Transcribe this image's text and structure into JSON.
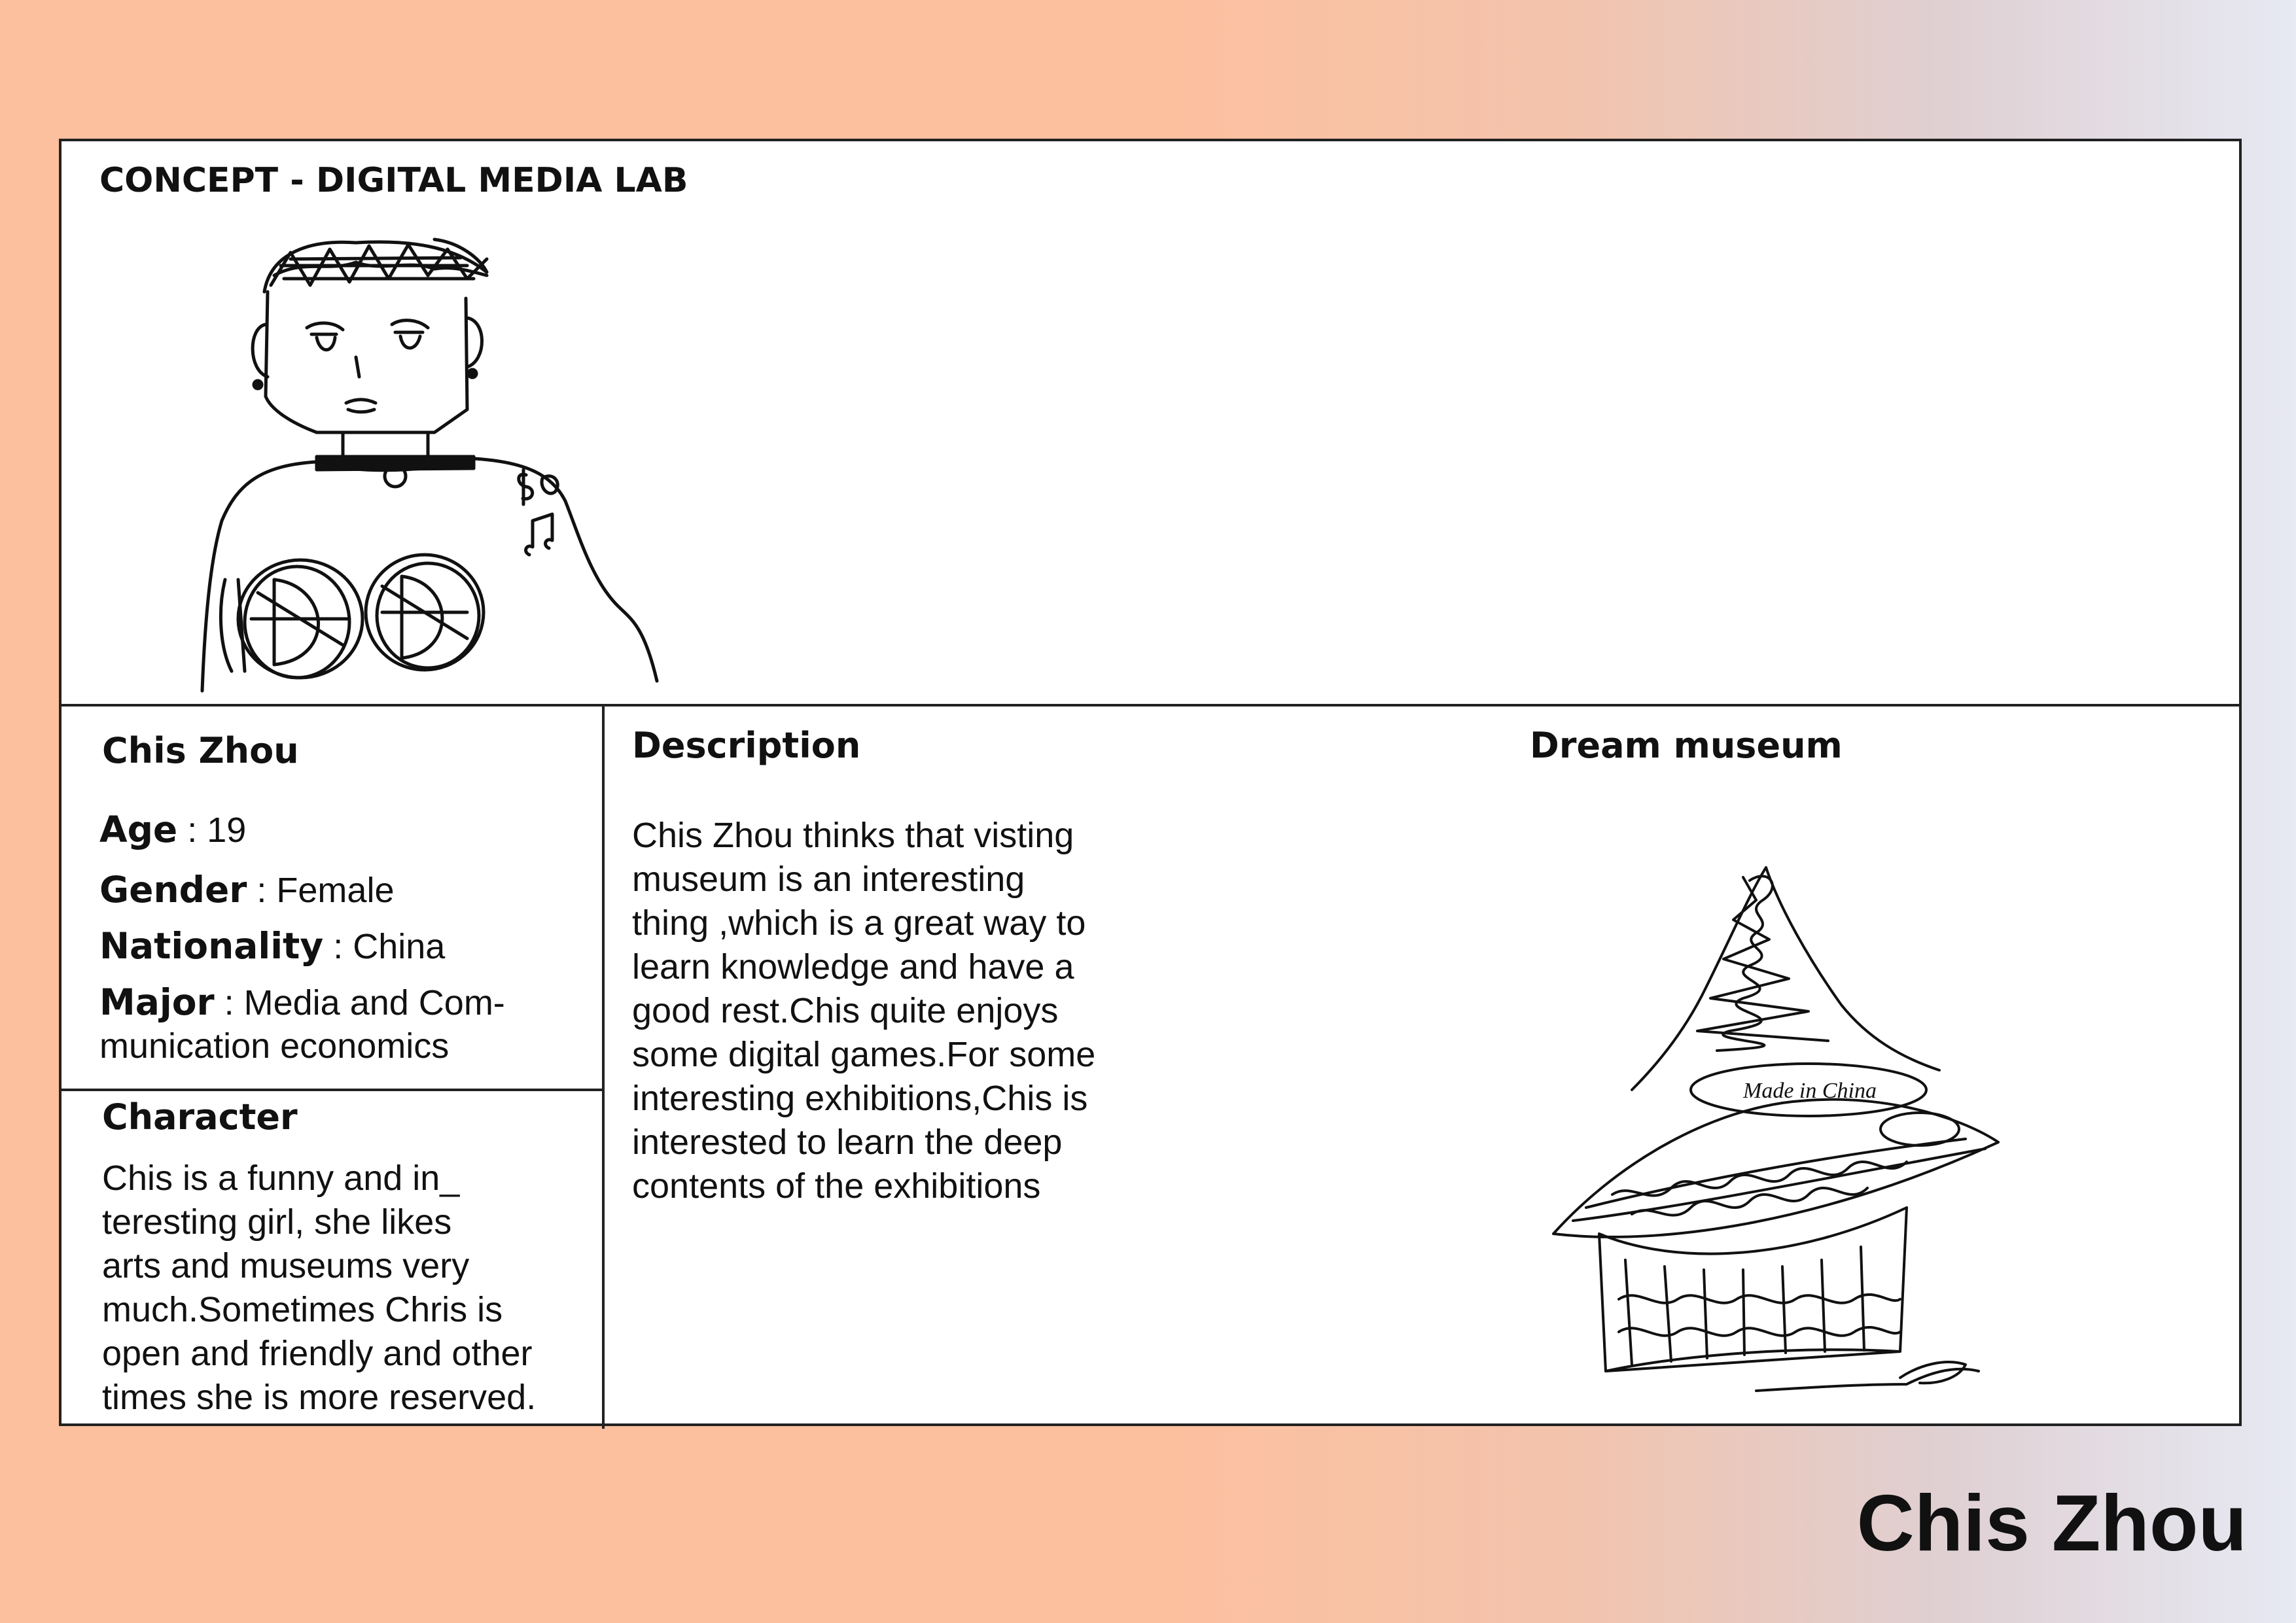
{
  "header": {
    "title": "CONCEPT - DIGITAL MEDIA LAB"
  },
  "profile": {
    "name": "Chis Zhou",
    "age_label": "Age",
    "age_value": " : 19",
    "gender_label": "Gender",
    "gender_value": " : Female",
    "nationality_label": "Nationality",
    "nationality_value": " : China",
    "major_label": "Major",
    "major_value_line1": " : Media and Com-",
    "major_value_line2": "munication economics"
  },
  "character": {
    "heading": "Character",
    "text": "Chis is a funny and in_\nteresting girl, she likes\narts and museums very\nmuch.Sometimes Chris is\nopen and friendly and other\ntimes she is more reserved."
  },
  "description": {
    "heading": "Description",
    "text": "Chis Zhou thinks that visting\nmuseum is an interesting\nthing ,which is a great way to\nlearn knowledge and have a\ngood rest.Chis quite enjoys\nsome digital games.For some\ninteresting exhibitions,Chis is\n interested to learn the deep\n contents of the exhibitions"
  },
  "dream": {
    "heading": "Dream museum",
    "sketch_label": "Made in China"
  },
  "footer": {
    "signature": "Chis Zhou"
  }
}
